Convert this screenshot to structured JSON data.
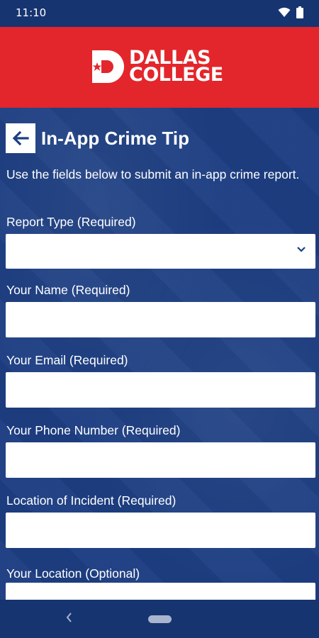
{
  "status_bar": {
    "time": "11:10",
    "icons": [
      "wifi-icon",
      "battery-icon"
    ]
  },
  "header": {
    "logo_line1": "DALLAS",
    "logo_line2": "COLLEGE",
    "brand_color": "#e3262b"
  },
  "page": {
    "title": "In-App Crime Tip",
    "intro": "Use the fields below to submit an in-app crime report."
  },
  "form": {
    "report_type": {
      "label": "Report Type (Required)",
      "value": ""
    },
    "name": {
      "label": "Your Name (Required)",
      "value": ""
    },
    "email": {
      "label": "Your Email (Required)",
      "value": ""
    },
    "phone": {
      "label": "Your Phone Number (Required)",
      "value": ""
    },
    "incident_location": {
      "label": "Location of Incident (Required)",
      "value": ""
    },
    "your_location": {
      "label": "Your Location (Optional)",
      "value": ""
    }
  },
  "colors": {
    "background": "#1d3e82",
    "status_bar": "#163470"
  }
}
